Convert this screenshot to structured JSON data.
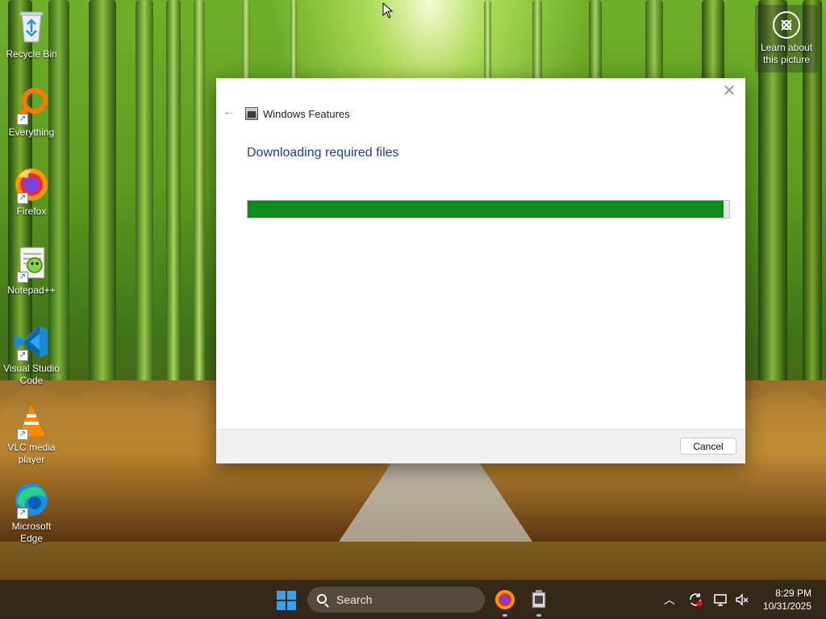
{
  "desktop": {
    "icons": [
      {
        "label": "Recycle Bin",
        "icon": "recycle-bin-icon"
      },
      {
        "label": "Everything",
        "icon": "everything-search-icon"
      },
      {
        "label": "Firefox",
        "icon": "firefox-icon"
      },
      {
        "label": "Notepad++",
        "icon": "notepad-plus-plus-icon"
      },
      {
        "label": "Visual Studio Code",
        "icon": "vscode-icon"
      },
      {
        "label": "VLC media player",
        "icon": "vlc-icon"
      },
      {
        "label": "Microsoft Edge",
        "icon": "edge-icon"
      }
    ],
    "learn_button": {
      "label": "Learn about this picture",
      "icon": "camera-icon"
    }
  },
  "dialog": {
    "title": "Windows Features",
    "heading": "Downloading required files",
    "progress_percent": 98.8,
    "cancel_label": "Cancel",
    "colors": {
      "progress": "#0f8a1c",
      "heading": "#1e3f8c"
    }
  },
  "taskbar": {
    "search_placeholder": "Search",
    "pinned": [
      "firefox-icon",
      "windows-features-icon"
    ],
    "tray": [
      "chevron-up-icon",
      "sync-icon",
      "network-icon",
      "volume-mute-icon"
    ],
    "time": "8:29 PM",
    "date": "10/31/2025"
  }
}
